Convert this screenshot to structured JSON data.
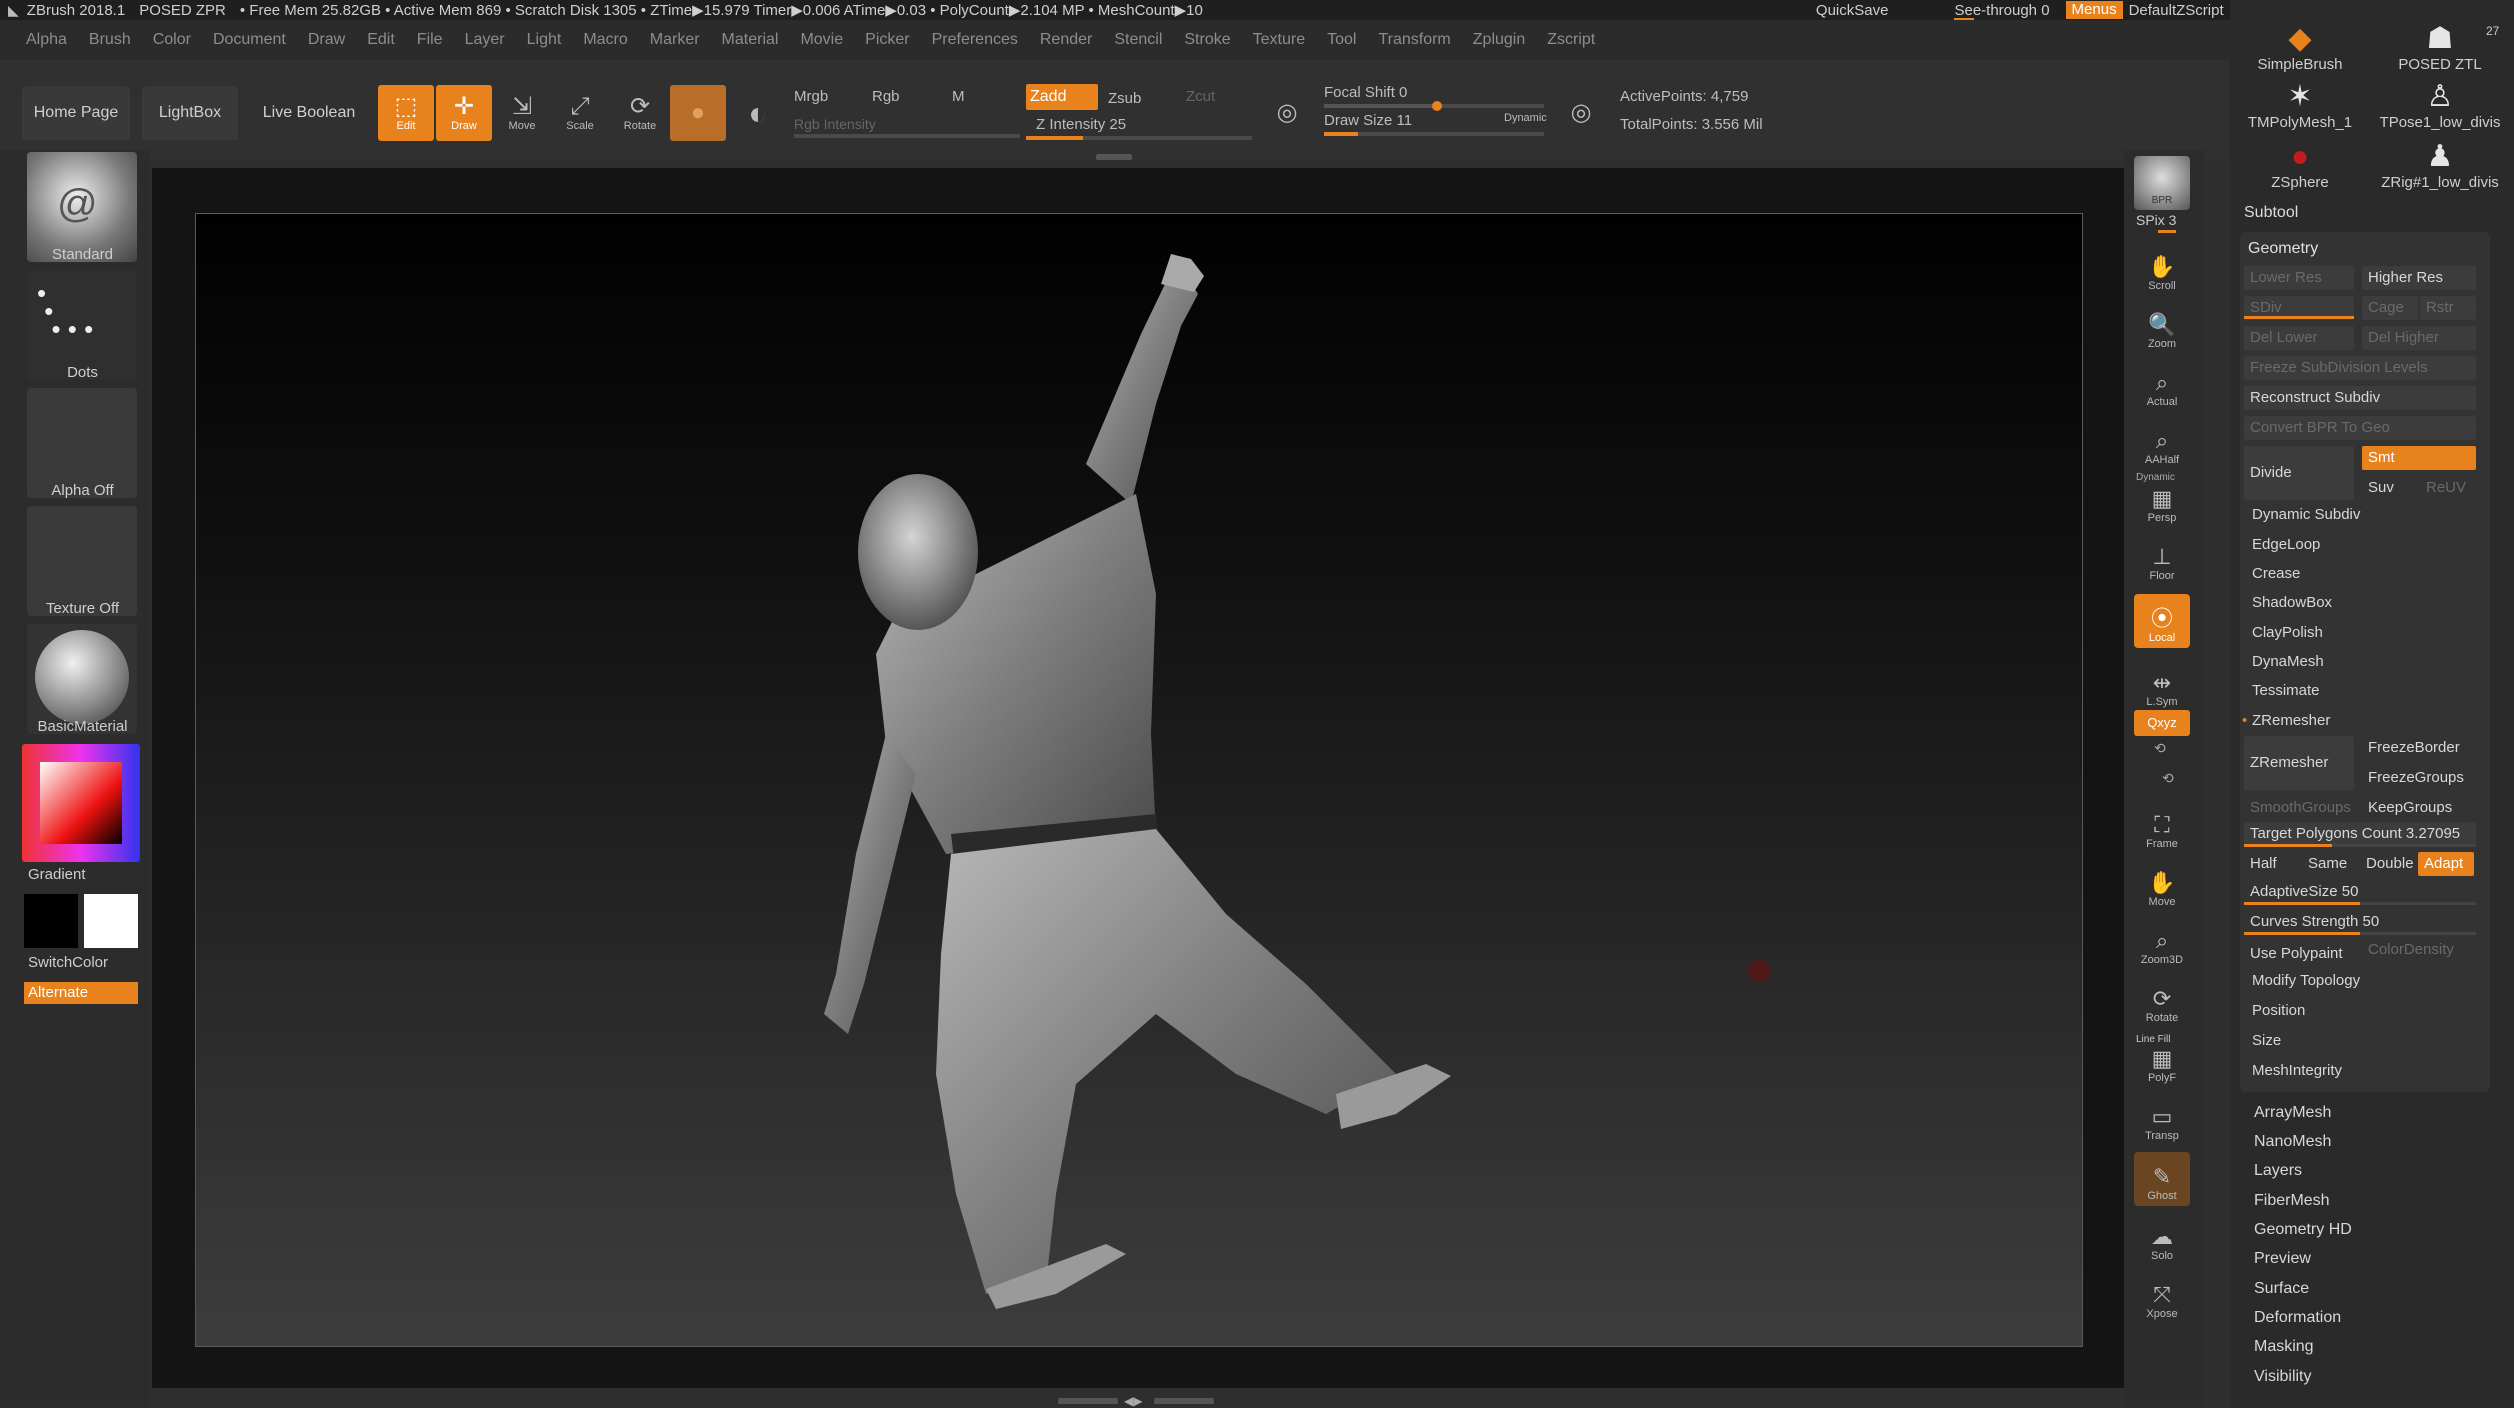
{
  "titlebar": {
    "app": "ZBrush 2018.1",
    "document": "POSED ZPR",
    "stats": "• Free Mem 25.82GB • Active Mem 869 • Scratch Disk 1305 • ZTime▶15.979 Timer▶0.006 ATime▶0.03 • PolyCount▶2.104 MP • MeshCount▶10",
    "quicksave": "QuickSave",
    "see_through": "See-through  0",
    "menus": "Menus",
    "script": "DefaultZScript"
  },
  "menubar": [
    "Alpha",
    "Brush",
    "Color",
    "Document",
    "Draw",
    "Edit",
    "File",
    "Layer",
    "Light",
    "Macro",
    "Marker",
    "Material",
    "Movie",
    "Picker",
    "Preferences",
    "Render",
    "Stencil",
    "Stroke",
    "Texture",
    "Tool",
    "Transform",
    "Zplugin",
    "Zscript"
  ],
  "toolbar": {
    "home_page": "Home Page",
    "lightbox": "LightBox",
    "live_boolean": "Live Boolean",
    "edit": "Edit",
    "draw": "Draw",
    "move": "Move",
    "scale": "Scale",
    "rotate": "Rotate",
    "mrgb": "Mrgb",
    "rgb": "Rgb",
    "m": "M",
    "rgb_intensity": "Rgb Intensity",
    "zadd": "Zadd",
    "zsub": "Zsub",
    "zcut": "Zcut",
    "z_intensity": "Z Intensity 25",
    "z_intensity_value": 25,
    "focal_shift": "Focal Shift 0",
    "draw_size": "Draw Size 11",
    "dynamic": "Dynamic",
    "active_points": "ActivePoints: 4,759",
    "total_points": "TotalPoints: 3.556 Mil"
  },
  "leftshelf": {
    "brush": "Standard",
    "stroke": "Dots",
    "alpha": "Alpha Off",
    "texture": "Texture Off",
    "material": "BasicMaterial",
    "gradient": "Gradient",
    "switchcolor": "SwitchColor",
    "alternate": "Alternate"
  },
  "rightshelf": {
    "bpr": "BPR",
    "spix": "SPix 3",
    "buttons": [
      "Scroll",
      "Zoom",
      "Actual",
      "AAHalf",
      "Persp",
      "Floor",
      "Local",
      "L.Sym",
      "Qxyz",
      "Frame",
      "Move",
      "Zoom3D",
      "Rotate",
      "PolyF",
      "Transp",
      "Ghost",
      "Solo",
      "Xpose"
    ],
    "dynamic": "Dynamic",
    "line_fill": "Line Fill"
  },
  "tray": {
    "brushes": [
      {
        "name": "SimpleBrush",
        "icon": "simplebrush-icon"
      },
      {
        "name": "POSED ZTL",
        "icon": "posed-figure-icon",
        "count": "27"
      },
      {
        "name": "TMPolyMesh_1",
        "icon": "star-icon"
      },
      {
        "name": "TPose1_low_divis",
        "icon": "tpose-figure-icon"
      },
      {
        "name": "ZSphere",
        "icon": "zsphere-icon"
      },
      {
        "name": "ZRig#1_low_divis",
        "icon": "zrig-figure-icon"
      }
    ],
    "subtool": "Subtool",
    "geometry": {
      "title": "Geometry",
      "lower_res": "Lower Res",
      "higher_res": "Higher Res",
      "sdiv": "SDiv",
      "cage": "Cage",
      "rstr": "Rstr",
      "del_lower": "Del Lower",
      "del_higher": "Del Higher",
      "freeze_subdiv": "Freeze SubDivision Levels",
      "reconstruct_subdiv": "Reconstruct Subdiv",
      "convert_bpr": "Convert BPR To Geo",
      "divide": "Divide",
      "smt": "Smt",
      "suv": "Suv",
      "reuv": "ReUV",
      "dynamic_subdiv": "Dynamic Subdiv",
      "edgeloop": "EdgeLoop",
      "crease": "Crease",
      "shadowbox": "ShadowBox",
      "claypolish": "ClayPolish",
      "dynamesh": "DynaMesh",
      "tessimate": "Tessimate",
      "zremesher_header": "ZRemesher",
      "zremesher_btn": "ZRemesher",
      "freezeborder": "FreezeBorder",
      "freezegroups": "FreezeGroups",
      "smoothgroups": "SmoothGroups",
      "keepgroups": "KeepGroups",
      "target_polygons": "Target Polygons Count 3.27095",
      "half": "Half",
      "same": "Same",
      "double": "Double",
      "adapt": "Adapt",
      "adaptive_size": "AdaptiveSize 50",
      "curves_strength": "Curves Strength 50",
      "use_polypaint": "Use Polypaint",
      "color_density": "ColorDensity",
      "modify_topology": "Modify Topology",
      "position": "Position",
      "size": "Size",
      "meshintegrity": "MeshIntegrity"
    },
    "items": [
      "ArrayMesh",
      "NanoMesh",
      "Layers",
      "FiberMesh",
      "Geometry HD",
      "Preview",
      "Surface",
      "Deformation",
      "Masking",
      "Visibility"
    ]
  },
  "colors": {
    "accent": "#e8821d",
    "background": "#2e2e2e",
    "canvas": "#141414"
  }
}
